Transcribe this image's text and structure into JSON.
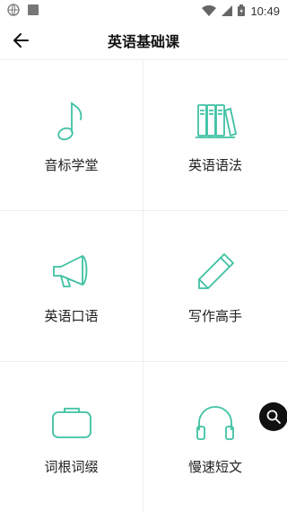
{
  "status_bar": {
    "time": "10:49",
    "icons": [
      "globe-icon",
      "square-icon",
      "wifi-icon",
      "signal-icon",
      "battery-icon"
    ]
  },
  "header": {
    "title": "英语基础课",
    "back_icon": "arrow-left-icon"
  },
  "courses": [
    {
      "label": "音标学堂",
      "icon": "music-note-icon"
    },
    {
      "label": "英语语法",
      "icon": "books-icon"
    },
    {
      "label": "英语口语",
      "icon": "megaphone-icon"
    },
    {
      "label": "写作高手",
      "icon": "pencil-icon"
    },
    {
      "label": "词根词缀",
      "icon": "bag-icon"
    },
    {
      "label": "慢速短文",
      "icon": "headphones-icon"
    }
  ],
  "fab": {
    "icon": "search-icon"
  },
  "colors": {
    "accent": "#3ec1a3",
    "fab": "#111111"
  }
}
